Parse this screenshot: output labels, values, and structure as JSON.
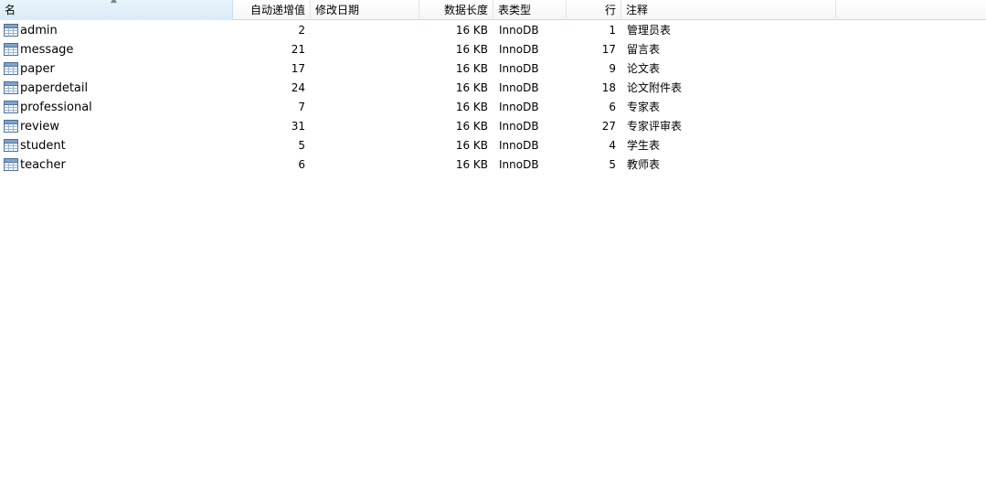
{
  "columns": {
    "name": "名",
    "auto_increment": "自动递增值",
    "modified": "修改日期",
    "data_length": "数据长度",
    "engine": "表类型",
    "rows": "行",
    "comment": "注释"
  },
  "icons": {
    "table": "table-icon",
    "sort": "sort-ascending-icon"
  },
  "colors": {
    "header_sorted": "#dcecf9",
    "icon_blue": "#4a6f9c"
  },
  "tables": [
    {
      "name": "admin",
      "auto_increment": "2",
      "modified": "",
      "data_length": "16 KB",
      "engine": "InnoDB",
      "rows": "1",
      "comment": "管理员表"
    },
    {
      "name": "message",
      "auto_increment": "21",
      "modified": "",
      "data_length": "16 KB",
      "engine": "InnoDB",
      "rows": "17",
      "comment": "留言表"
    },
    {
      "name": "paper",
      "auto_increment": "17",
      "modified": "",
      "data_length": "16 KB",
      "engine": "InnoDB",
      "rows": "9",
      "comment": "论文表"
    },
    {
      "name": "paperdetail",
      "auto_increment": "24",
      "modified": "",
      "data_length": "16 KB",
      "engine": "InnoDB",
      "rows": "18",
      "comment": "论文附件表"
    },
    {
      "name": "professional",
      "auto_increment": "7",
      "modified": "",
      "data_length": "16 KB",
      "engine": "InnoDB",
      "rows": "6",
      "comment": "专家表"
    },
    {
      "name": "review",
      "auto_increment": "31",
      "modified": "",
      "data_length": "16 KB",
      "engine": "InnoDB",
      "rows": "27",
      "comment": "专家评审表"
    },
    {
      "name": "student",
      "auto_increment": "5",
      "modified": "",
      "data_length": "16 KB",
      "engine": "InnoDB",
      "rows": "4",
      "comment": "学生表"
    },
    {
      "name": "teacher",
      "auto_increment": "6",
      "modified": "",
      "data_length": "16 KB",
      "engine": "InnoDB",
      "rows": "5",
      "comment": "教师表"
    }
  ]
}
